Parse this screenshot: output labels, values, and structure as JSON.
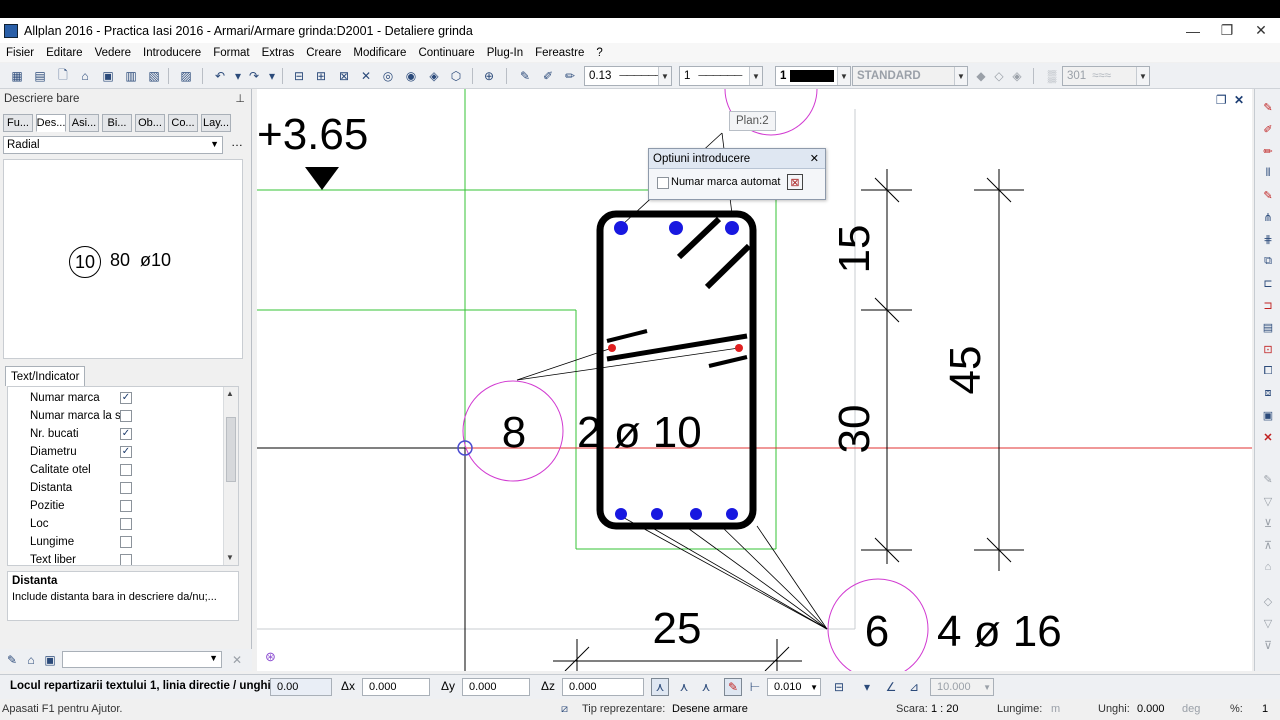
{
  "window": {
    "title": "Allplan 2016 - Practica Iasi 2016 - Armari/Armare grinda:D2001 - Detaliere grinda"
  },
  "menu": [
    "Fisier",
    "Editare",
    "Vedere",
    "Introducere",
    "Format",
    "Extras",
    "Creare",
    "Modificare",
    "Continuare",
    "Plug-In",
    "Fereastre",
    "?"
  ],
  "toolbar": {
    "pen_thickness": "0.13",
    "line_type": "1",
    "color": "1",
    "layer": "STANDARD",
    "hatch": "301"
  },
  "left_panel": {
    "title": "Descriere bare",
    "tabs": [
      "Fu...",
      "Des...",
      "Asi...",
      "Bi...",
      "Ob...",
      "Co...",
      "Lay..."
    ],
    "active_tab": 1,
    "mode": "Radial",
    "preview": {
      "mark": "10",
      "count": "80",
      "diameter": "ø10"
    },
    "subtab": "Text/Indicator",
    "options": [
      {
        "label": "Numar marca",
        "checked": true
      },
      {
        "label": "Numar marca la s",
        "checked": false
      },
      {
        "label": "Nr. bucati",
        "checked": true
      },
      {
        "label": "Diametru",
        "checked": true
      },
      {
        "label": "Calitate otel",
        "checked": false
      },
      {
        "label": "Distanta",
        "checked": false
      },
      {
        "label": "Pozitie",
        "checked": false
      },
      {
        "label": "Loc",
        "checked": false
      },
      {
        "label": "Lungime",
        "checked": false
      },
      {
        "label": "Text liber",
        "checked": false
      }
    ],
    "description_title": "Distanta",
    "description_text": "Include distanta bara in descriere da/nu;..."
  },
  "popup": {
    "title": "Optiuni introducere",
    "checkbox_label": "Numar marca automat"
  },
  "drawing": {
    "elevation": "+3.65",
    "plan_label": "Plan:2",
    "mark_top": "8",
    "label_top": "2 ø 10",
    "mark_bottom": "6",
    "label_bottom": "4 ø 16",
    "dim_15": "15",
    "dim_30": "30",
    "dim_45": "45",
    "dim_25": "25"
  },
  "input_bar": {
    "prompt": "Locul repartizarii textului 1, linia directie / unghi",
    "angle": "0.00",
    "dx_label": "Δx",
    "dx": "0.000",
    "dy_label": "Δy",
    "dy": "0.000",
    "dz_label": "Δz",
    "dz": "0.000",
    "snap_value": "0.010",
    "scale_value": "10.000"
  },
  "status_bar": {
    "help": "Apasati F1 pentru Ajutor.",
    "repr_label": "Tip reprezentare:",
    "repr_value": "Desene armare",
    "scale_label": "Scara:",
    "scale_value": "1 : 20",
    "length_label": "Lungime:",
    "length_unit": "m",
    "angle_label": "Unghi:",
    "angle_value": "0.000",
    "angle_unit": "deg",
    "percent_label": "%:",
    "percent_value": "1"
  },
  "colors": {
    "canvas_bg": "#ffffff",
    "guide_green": "#34c334",
    "axis_red": "#e03030",
    "circle_magenta": "#d13ad1",
    "bar_blue": "#1818e0"
  }
}
